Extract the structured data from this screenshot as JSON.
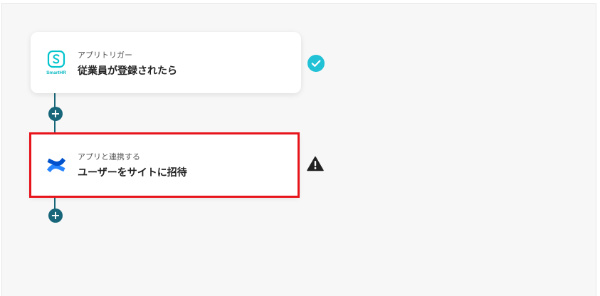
{
  "flow": {
    "steps": [
      {
        "category": "アプリトリガー",
        "title": "従業員が登録されたら",
        "app_icon": "smarthr-logo-icon",
        "app_label": "SmartHR",
        "status_icon": "check-circle-icon",
        "status": "completed"
      },
      {
        "category": "アプリと連携する",
        "title": "ユーザーをサイトに招待",
        "app_icon": "confluence-logo-icon",
        "status_icon": "warning-triangle-icon",
        "status": "warning",
        "highlighted": true
      }
    ],
    "add_step_buttons": [
      "+",
      "+"
    ]
  },
  "colors": {
    "connector": "#18667a",
    "check": "#21c1d6",
    "warning": "#222222",
    "highlight": "#e8141c",
    "smarthr": "#00c4cc",
    "confluence_dark": "#0052cc",
    "confluence_light": "#2684ff"
  }
}
